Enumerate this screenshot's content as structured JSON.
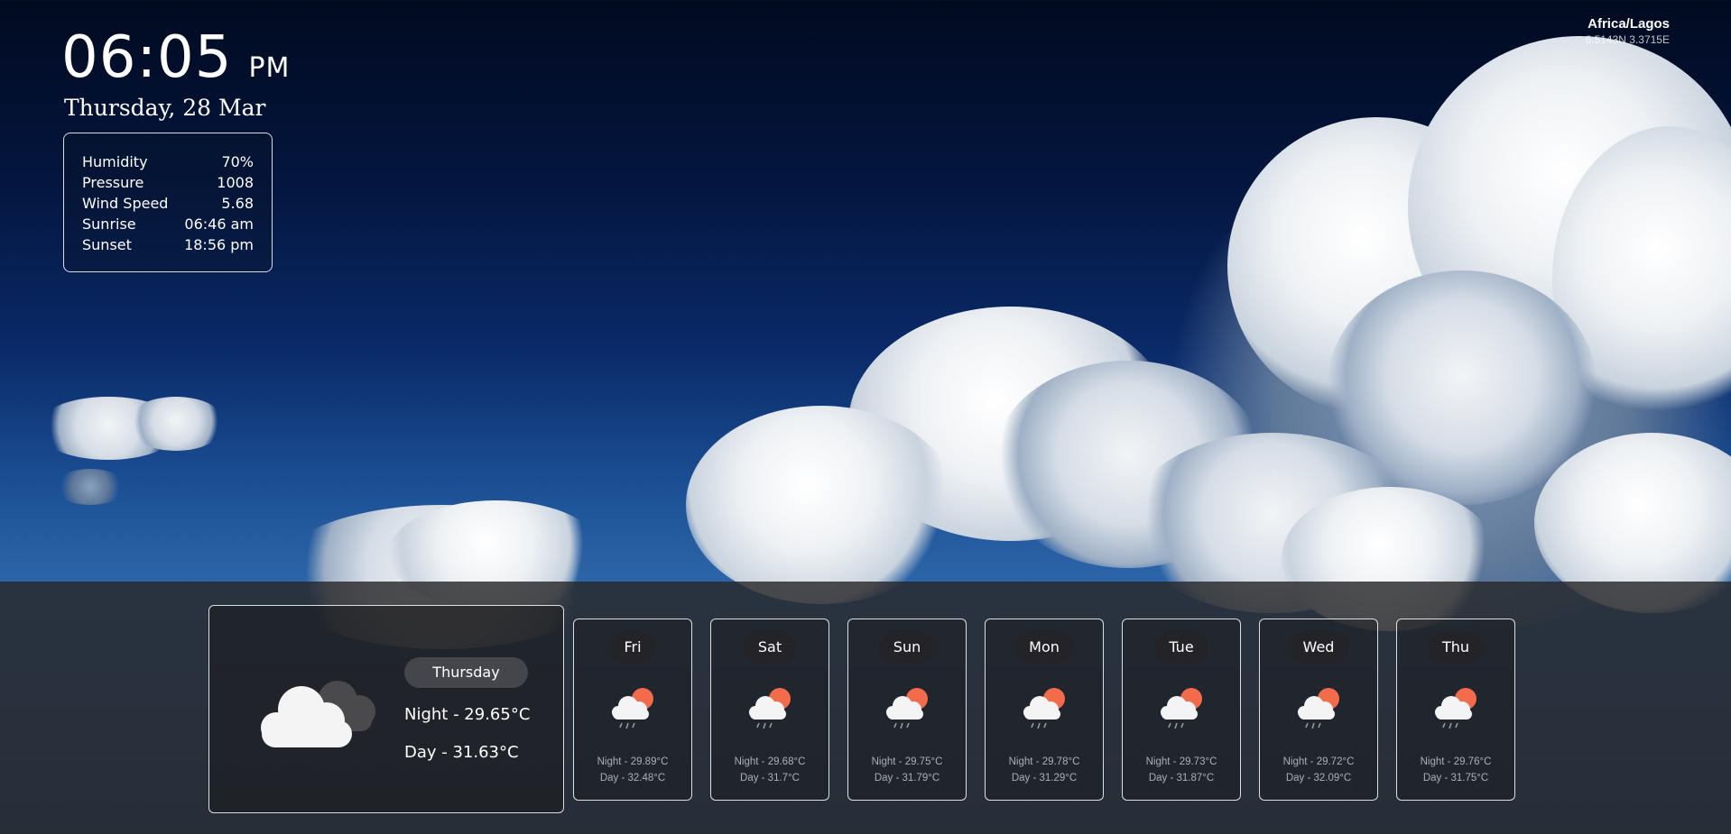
{
  "clock": {
    "time": "06:05",
    "ampm": "PM"
  },
  "date": "Thursday, 28 Mar",
  "stats": [
    {
      "label": "Humidity",
      "value": "70%"
    },
    {
      "label": "Pressure",
      "value": "1008"
    },
    {
      "label": "Wind Speed",
      "value": "5.68"
    },
    {
      "label": "Sunrise",
      "value": "06:46 am"
    },
    {
      "label": "Sunset",
      "value": "18:56 pm"
    }
  ],
  "location": {
    "timezone": "Africa/Lagos",
    "coords": "6.5143N 3.3715E"
  },
  "today": {
    "day": "Thursday",
    "night": "Night - 29.65°C",
    "day_temp": "Day - 31.63°C",
    "icon": "cloudy-icon"
  },
  "forecast": [
    {
      "day": "Fri",
      "night": "Night - 29.89°C",
      "day_temp": "Day - 32.48°C",
      "icon": "rain-sun-icon"
    },
    {
      "day": "Sat",
      "night": "Night - 29.68°C",
      "day_temp": "Day - 31.7°C",
      "icon": "rain-sun-icon"
    },
    {
      "day": "Sun",
      "night": "Night - 29.75°C",
      "day_temp": "Day - 31.79°C",
      "icon": "rain-sun-icon"
    },
    {
      "day": "Mon",
      "night": "Night - 29.78°C",
      "day_temp": "Day - 31.29°C",
      "icon": "rain-sun-icon"
    },
    {
      "day": "Tue",
      "night": "Night - 29.73°C",
      "day_temp": "Day - 31.87°C",
      "icon": "rain-sun-icon"
    },
    {
      "day": "Wed",
      "night": "Night - 29.72°C",
      "day_temp": "Day - 32.09°C",
      "icon": "rain-sun-icon"
    },
    {
      "day": "Thu",
      "night": "Night - 29.76°C",
      "day_temp": "Day - 31.75°C",
      "icon": "rain-sun-icon"
    }
  ],
  "colors": {
    "sun": "#f26b4a",
    "cloud": "#f4f4f4",
    "panel": "#28282a",
    "pill": "#45464b"
  }
}
